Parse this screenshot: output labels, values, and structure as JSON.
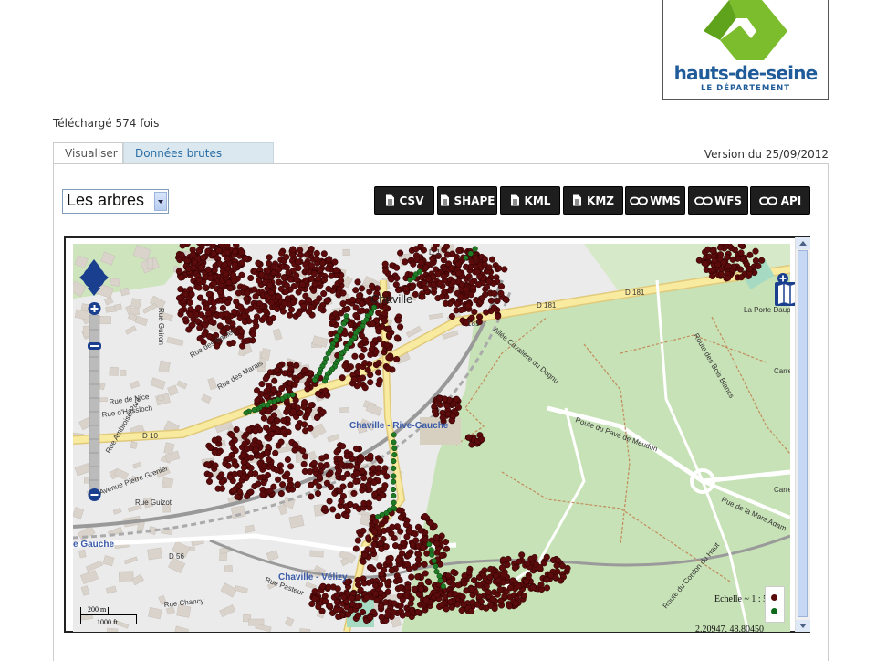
{
  "logo": {
    "wordmark": "hauts-de-seine",
    "sub": "LE DÉPARTEMENT",
    "color_green": "#7bbd2c",
    "color_blue": "#1f5c99"
  },
  "downloads": "Téléchargé 574 fois",
  "tabs": [
    {
      "label": "Visualiser",
      "active": true
    },
    {
      "label": "Données brutes",
      "active": false
    }
  ],
  "version": "Version du 25/09/2012",
  "layer_select": {
    "value": "Les arbres"
  },
  "formats": [
    {
      "label": "CSV",
      "icon": "document-icon"
    },
    {
      "label": "SHAPE",
      "icon": "document-icon"
    },
    {
      "label": "KML",
      "icon": "document-icon"
    },
    {
      "label": "KMZ",
      "icon": "document-icon"
    },
    {
      "label": "WMS",
      "icon": "link-icon"
    },
    {
      "label": "WFS",
      "icon": "link-icon"
    },
    {
      "label": "API",
      "icon": "link-icon"
    }
  ],
  "map": {
    "labels": {
      "chaville": "Chaville",
      "rive_gauche": "Chaville - Rive-Gauche",
      "velizy": "Chaville - Vélizy",
      "gauche": "e Gauche",
      "porte": "La Porte Dauphi",
      "carref1": "Carref",
      "carref2": "Carrefo",
      "d10": "D 10",
      "d56": "D 56",
      "d181a": "D 181",
      "d181b": "D 181",
      "d181c": "181",
      "d1": "D 1",
      "rue_nice": "Rue de Nice",
      "rue_hassloch": "Rue d'Hassloch",
      "rue_guizot": "Rue Guizot",
      "rue_chancy": "Rue Chancy",
      "rue_sables": "Rue des Sables",
      "rue_marais": "Rue des Marais",
      "rue_guiron": "Rue Guiron",
      "rue_pasteur": "Rue Pasteur",
      "rue_mare": "Rue de la Mare Adam",
      "rue_pave": "Route du Pavé de Meudon",
      "rue_bois": "Route des Bois Blancs",
      "rue_pierre": "Avenue Pierre Grenier",
      "rue_ambroise": "Rue Ambroise Paré",
      "allee": "Allée Cavalière du Dognu",
      "route_cordon": "Route du Cordon du Haut",
      "echelle": "Echelle ~ 1 : 5K",
      "coords": "2.20947, 48.80450",
      "scale_top": "200 m",
      "scale_bot": "1000 ft"
    },
    "colors": {
      "forest": "#c5e3b5",
      "urban": "#ececec",
      "road_main": "#f9e8a8",
      "tree_dot": "#5b0b0b",
      "tree_dot_green": "#1f7a26",
      "water": "#c8dff0"
    }
  },
  "legend": {
    "icon1": "tree-dot-red",
    "icon2": "tree-dot-green"
  }
}
